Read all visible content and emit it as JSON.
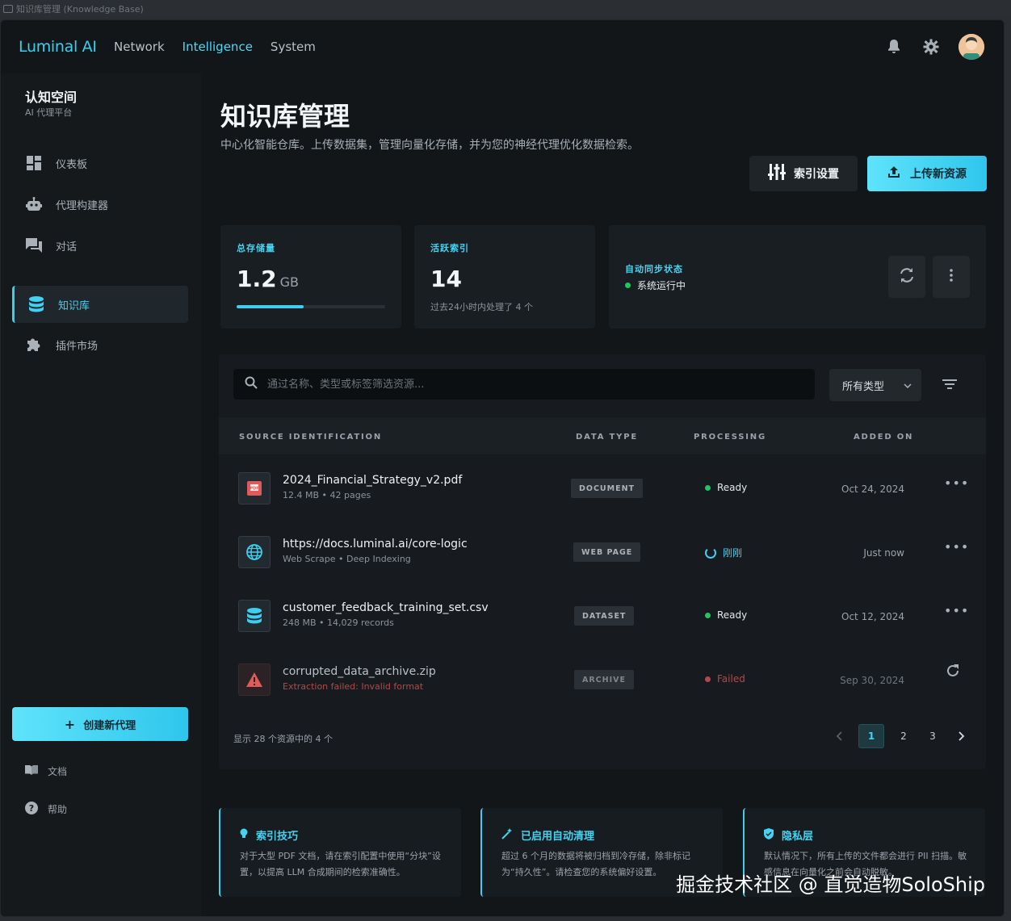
{
  "window_title": "知识库管理 (Knowledge Base)",
  "brand": "Luminal AI",
  "topnav": {
    "links": [
      {
        "label": "Network"
      },
      {
        "label": "Intelligence"
      },
      {
        "label": "System"
      }
    ],
    "active": "Intelligence"
  },
  "sidebar": {
    "title": "认知空间",
    "subtitle": "AI 代理平台",
    "items": [
      {
        "label": "仪表板",
        "icon": "dashboard-icon"
      },
      {
        "label": "代理构建器",
        "icon": "robot-icon"
      },
      {
        "label": "对话",
        "icon": "chat-icon"
      },
      {
        "label": "知识库",
        "icon": "database-icon"
      },
      {
        "label": "插件市场",
        "icon": "puzzle-icon"
      }
    ],
    "active_index": 3,
    "create_button": "创建新代理",
    "docs": "文档",
    "help": "帮助"
  },
  "page": {
    "title": "知识库管理",
    "description": "中心化智能仓库。上传数据集，管理向量化存储，并为您的神经代理优化数据检索。",
    "index_settings_button": "索引设置",
    "upload_button": "上传新资源"
  },
  "stats": {
    "storage": {
      "label": "总存储量",
      "value": "1.2",
      "unit": "GB",
      "progress": 0.45
    },
    "active_index": {
      "label": "活跃索引",
      "value": "14",
      "sub": "过去24小时内处理了 4 个"
    },
    "sync": {
      "label": "自动同步状态",
      "status": "系统运行中",
      "status_color": "#22c55e"
    }
  },
  "filters": {
    "search_placeholder": "通过名称、类型或标签筛选资源...",
    "type_select": "所有类型"
  },
  "table": {
    "headers": [
      "SOURCE IDENTIFICATION",
      "DATA TYPE",
      "PROCESSING",
      "ADDED ON"
    ],
    "rows": [
      {
        "name": "2024_Financial_Strategy_v2.pdf",
        "meta": "12.4 MB • 42 pages",
        "type": "DOCUMENT",
        "status": "Ready",
        "status_color": "#22c55e",
        "added": "Oct 24, 2024",
        "icon": "pdf-icon"
      },
      {
        "name": "https://docs.luminal.ai/core-logic",
        "meta": "Web Scrape • Deep Indexing",
        "type": "WEB PAGE",
        "status": "刚刚",
        "status_color": "#3ecff0",
        "added": "Just now",
        "icon": "globe-icon"
      },
      {
        "name": "customer_feedback_training_set.csv",
        "meta": "248 MB • 14,029 records",
        "type": "DATASET",
        "status": "Ready",
        "status_color": "#22c55e",
        "added": "Oct 12, 2024",
        "icon": "database-icon"
      },
      {
        "name": "corrupted_data_archive.zip",
        "meta": "Extraction failed: Invalid format",
        "type": "ARCHIVE",
        "status": "Failed",
        "status_color": "#e05a5a",
        "added": "Sep 30, 2024",
        "icon": "warning-icon"
      }
    ],
    "footer": "显示 28 个资源中的 4 个",
    "pages": [
      "1",
      "2",
      "3"
    ],
    "current_page": "1"
  },
  "tips": [
    {
      "title": "索引技巧",
      "body": "对于大型 PDF 文档，请在索引配置中使用“分块”设置，以提高 LLM 合成期间的检索准确性。",
      "icon": "lightbulb-icon"
    },
    {
      "title": "已启用自动清理",
      "body": "超过 6 个月的数据将被归档到冷存储，除非标记为“持久性”。请检查您的系统偏好设置。",
      "icon": "magic-wand-icon"
    },
    {
      "title": "隐私层",
      "body": "默认情况下，所有上传的文件都会进行 PII 扫描。敏感信息在向量化之前会自动脱敏。",
      "icon": "shield-icon"
    }
  ],
  "watermark": "掘金技术社区 @ 直觉造物SoloShip"
}
